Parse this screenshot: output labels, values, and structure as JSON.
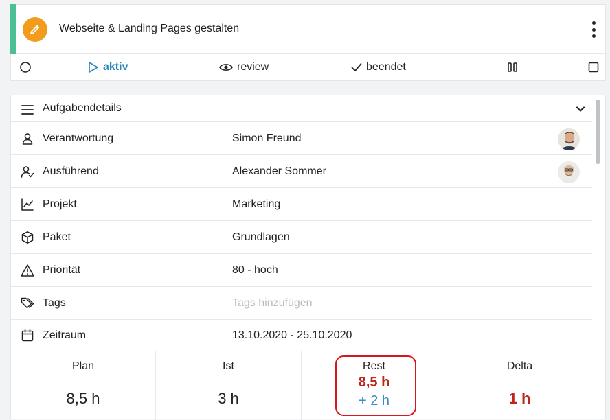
{
  "task": {
    "title": "Webseite & Landing Pages gestalten"
  },
  "status_bar": {
    "items": [
      {
        "label": ""
      },
      {
        "label": "aktiv"
      },
      {
        "label": "review"
      },
      {
        "label": "beendet"
      },
      {
        "label": ""
      },
      {
        "label": ""
      }
    ]
  },
  "details": {
    "section_title": "Aufgabendetails",
    "rows": [
      {
        "label": "Verantwortung",
        "value": "Simon Freund"
      },
      {
        "label": "Ausführend",
        "value": "Alexander Sommer"
      },
      {
        "label": "Projekt",
        "value": "Marketing"
      },
      {
        "label": "Paket",
        "value": "Grundlagen"
      },
      {
        "label": "Priorität",
        "value": "80 - hoch"
      },
      {
        "label": "Tags",
        "placeholder": "Tags hinzufügen"
      },
      {
        "label": "Zeitraum",
        "value": "13.10.2020 - 25.10.2020"
      }
    ]
  },
  "stats": {
    "plan": {
      "label": "Plan",
      "value": "8,5 h"
    },
    "ist": {
      "label": "Ist",
      "value": "3 h"
    },
    "rest": {
      "label": "Rest",
      "value": "8,5 h",
      "extra": "+ 2 h"
    },
    "delta": {
      "label": "Delta",
      "value": "1 h"
    }
  },
  "colors": {
    "accent_green": "#4cbf95",
    "edit_orange": "#f39b1a",
    "active_blue": "#2a84b8",
    "alert_red": "#c0251b",
    "highlight_red": "#d8171c"
  },
  "icons": [
    "pencil-icon",
    "more-vertical-icon",
    "circle-icon",
    "play-icon",
    "eye-icon",
    "check-icon",
    "pause-icon",
    "square-icon",
    "menu-icon",
    "chevron-down-icon",
    "user-icon",
    "user-check-icon",
    "chart-line-icon",
    "package-icon",
    "alert-triangle-icon",
    "tags-icon",
    "calendar-icon"
  ]
}
